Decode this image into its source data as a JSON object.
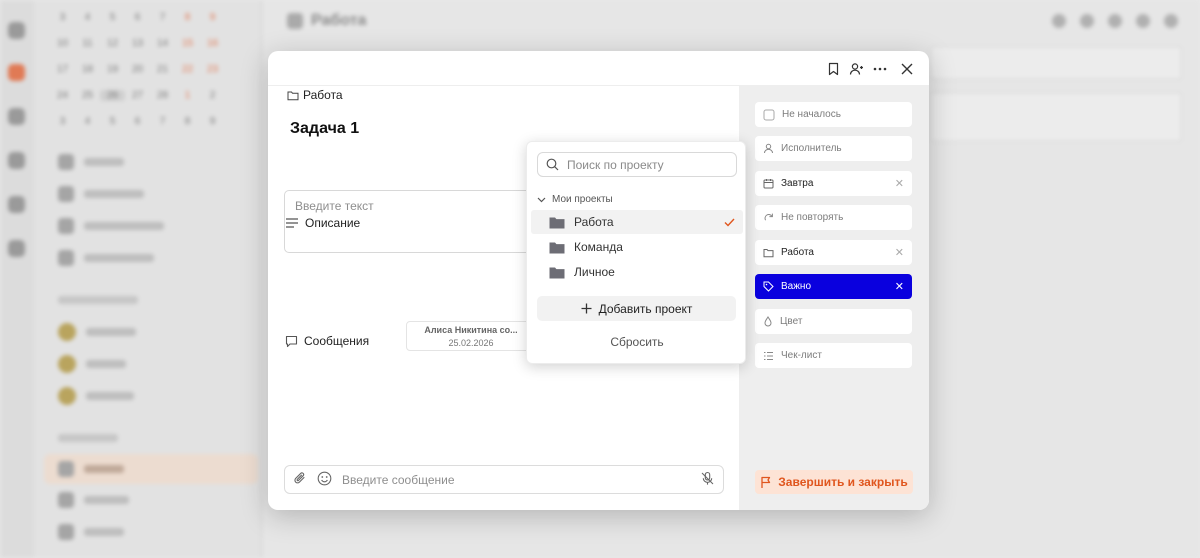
{
  "background": {
    "calendar_rows": [
      [
        "3",
        "4",
        "5",
        "6",
        "7",
        "8",
        "9"
      ],
      [
        "10",
        "11",
        "12",
        "13",
        "14",
        "15",
        "16"
      ],
      [
        "17",
        "18",
        "19",
        "20",
        "21",
        "22",
        "23"
      ],
      [
        "24",
        "25",
        "26",
        "27",
        "28",
        "1",
        "2"
      ],
      [
        "3",
        "4",
        "5",
        "6",
        "7",
        "8",
        "9"
      ]
    ],
    "project_title": "Работа"
  },
  "breadcrumb": {
    "project": "Работа"
  },
  "task": {
    "title": "Задача 1",
    "description_heading": "Описание",
    "description_placeholder": "Введите текст",
    "messages_heading": "Сообщения",
    "message_author": "Алиса Никитина со...",
    "message_date": "25.02.2026",
    "message_placeholder": "Введите сообщение"
  },
  "properties": {
    "status": "Не началось",
    "assignee": "Исполнитель",
    "due": "Завтра",
    "repeat": "Не повторять",
    "project": "Работа",
    "priority": "Важно",
    "color": "Цвет",
    "checklist": "Чек-лист",
    "finish_button": "Завершить и закрыть",
    "accent_color": "#0a00de",
    "finish_color": "#e0561e"
  },
  "project_dropdown": {
    "search_placeholder": "Поиск по проекту",
    "group_label": "Мои проекты",
    "items": [
      {
        "label": "Работа",
        "selected": true
      },
      {
        "label": "Команда",
        "selected": false
      },
      {
        "label": "Личное",
        "selected": false
      }
    ],
    "add_label": "Добавить проект",
    "reset_label": "Сбросить"
  }
}
